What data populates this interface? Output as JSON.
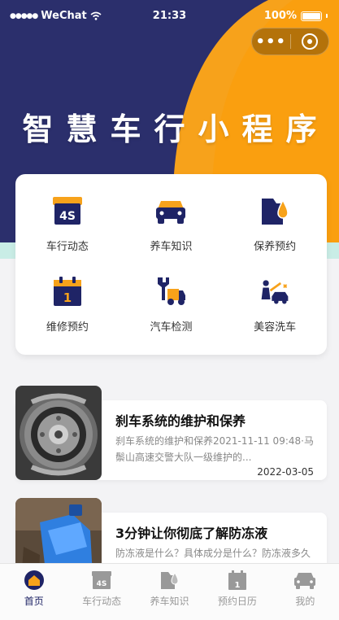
{
  "status_bar": {
    "signal": "●●●●●",
    "carrier": "WeChat",
    "time": "21:33",
    "battery": "100%"
  },
  "capsule": {
    "more": "•••"
  },
  "hero": {
    "title": "智慧车行小程序"
  },
  "colors": {
    "navy": "#2b2f6c",
    "orange": "#f7a21b",
    "mint": "#c9ede6",
    "active_tab": "#1f2466"
  },
  "grid": [
    {
      "label": "车行动态",
      "icon": "4s-store-icon",
      "badge": "4S"
    },
    {
      "label": "养车知识",
      "icon": "car-front-icon"
    },
    {
      "label": "保养预约",
      "icon": "oil-drop-icon"
    },
    {
      "label": "维修预约",
      "icon": "calendar-icon",
      "badge": "1"
    },
    {
      "label": "汽车检测",
      "icon": "wrench-truck-icon"
    },
    {
      "label": "美容洗车",
      "icon": "car-wash-icon"
    }
  ],
  "articles": [
    {
      "title": "刹车系统的维护和保养",
      "desc": "刹车系统的维护和保养2021-11-11 09:48·马鬃山高速交警大队一级维护的...",
      "date": "2022-03-05",
      "thumb": "brake-system-photo"
    },
    {
      "title": "3分钟让你彻底了解防冻液",
      "desc": "防冻液是什么？具体成分是什么？防冻液多久更换一次？如何选择合适...",
      "date": "",
      "thumb": "antifreeze-bottle-photo"
    }
  ],
  "tabs": [
    {
      "label": "首页",
      "icon": "home-icon",
      "active": true
    },
    {
      "label": "车行动态",
      "icon": "4s-store-icon",
      "active": false
    },
    {
      "label": "养车知识",
      "icon": "oil-drop-icon",
      "active": false
    },
    {
      "label": "预约日历",
      "icon": "calendar-icon",
      "active": false
    },
    {
      "label": "我的",
      "icon": "car-front-icon",
      "active": false
    }
  ]
}
